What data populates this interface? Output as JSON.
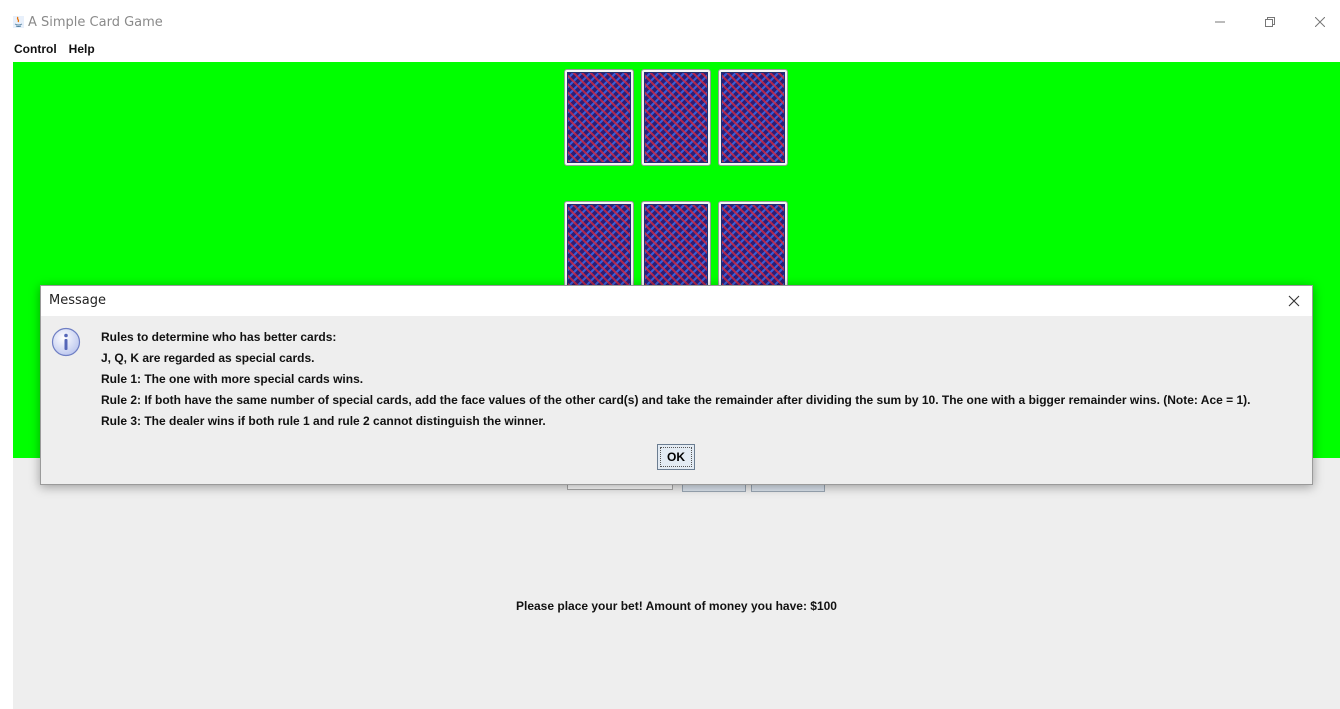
{
  "window": {
    "title": "A Simple Card Game",
    "icon": "java-icon",
    "controls": [
      "minimize-icon",
      "restore-icon",
      "close-icon"
    ]
  },
  "menu": {
    "items": [
      {
        "label": "Control"
      },
      {
        "label": "Help"
      }
    ]
  },
  "table": {
    "background_color": "#00ff00",
    "dealer_cards": [
      "face-down",
      "face-down",
      "face-down"
    ],
    "player_cards": [
      "face-down",
      "face-down",
      "face-down"
    ]
  },
  "bet": {
    "input_value": "",
    "buttons": [
      "",
      ""
    ]
  },
  "status": {
    "text": "Please place your bet!  Amount of money you have: $100"
  },
  "dialog": {
    "title": "Message",
    "icon": "info-icon",
    "lines": [
      "Rules to determine who has better cards:",
      "J, Q, K are regarded as special cards.",
      "Rule 1: The one with more special cards wins.",
      "Rule 2: If both have the same number of special cards, add the face values of the other card(s) and take the remainder after dividing the sum by 10. The one with a bigger remainder wins. (Note: Ace = 1).",
      "Rule 3: The dealer wins if both rule 1 and rule 2 cannot distinguish the winner."
    ],
    "ok_label": "OK"
  }
}
